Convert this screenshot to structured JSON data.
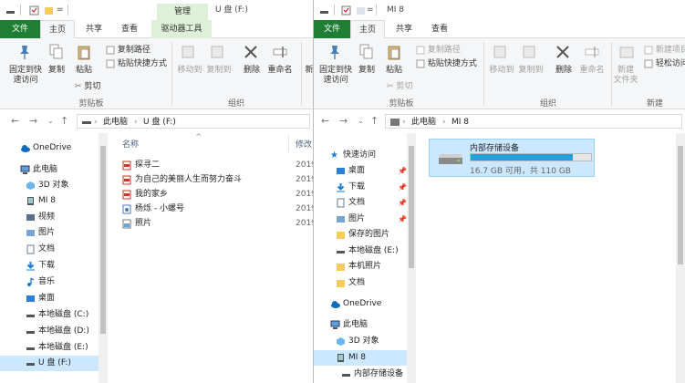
{
  "left_window": {
    "title": "U 盘 (F:)",
    "context_header": "管理",
    "tabs": [
      "文件",
      "主页",
      "共享",
      "查看",
      "驱动器工具"
    ],
    "ribbon": {
      "pin": "固定到快\n速访问",
      "copy": "复制",
      "paste": "粘贴",
      "copy_path": "复制路径",
      "paste_shortcut": "粘贴快捷方式",
      "cut": "剪切",
      "move_to": "移动到",
      "copy_to": "复制到",
      "delete": "删除",
      "rename": "重命名",
      "new": "新",
      "group_clipboard": "剪贴板",
      "group_organize": "组织"
    },
    "breadcrumb": [
      "此电脑",
      "U 盘 (F:)"
    ],
    "columns": {
      "name": "名称",
      "modified": "修改"
    },
    "files": [
      {
        "name": "探寻二",
        "date": "2019"
      },
      {
        "name": "为自己的美丽人生而努力奋斗",
        "date": "2019"
      },
      {
        "name": "我的家乡",
        "date": "2019"
      },
      {
        "name": "杨烁 - 小螺号",
        "date": "2019"
      },
      {
        "name": "照片",
        "date": "2019"
      }
    ],
    "nav": [
      {
        "label": "OneDrive"
      },
      {
        "label": "此电脑"
      },
      {
        "label": "3D 对象"
      },
      {
        "label": "MI 8"
      },
      {
        "label": "视频"
      },
      {
        "label": "图片"
      },
      {
        "label": "文档"
      },
      {
        "label": "下载"
      },
      {
        "label": "音乐"
      },
      {
        "label": "桌面"
      },
      {
        "label": "本地磁盘 (C:)"
      },
      {
        "label": "本地磁盘 (D:)"
      },
      {
        "label": "本地磁盘 (E:)"
      },
      {
        "label": "U 盘 (F:)"
      }
    ]
  },
  "right_window": {
    "title": "MI 8",
    "tabs": [
      "文件",
      "主页",
      "共享",
      "查看"
    ],
    "ribbon": {
      "pin": "固定到快\n速访问",
      "copy": "复制",
      "paste": "粘贴",
      "copy_path": "复制路径",
      "paste_shortcut": "粘贴快捷方式",
      "cut": "剪切",
      "move_to": "移动到",
      "copy_to": "复制到",
      "delete": "删除",
      "rename": "重命名",
      "new_folder": "新建\n文件夹",
      "new_item": "新建项目",
      "easy_access": "轻松访问",
      "group_clipboard": "剪贴板",
      "group_organize": "组织",
      "group_new": "新建"
    },
    "breadcrumb": [
      "此电脑",
      "MI 8"
    ],
    "storage": {
      "name": "内部存储设备",
      "info": "16.7 GB 可用，共 110 GB",
      "used_fraction": 0.85
    },
    "nav": [
      {
        "label": "快速访问"
      },
      {
        "label": "桌面"
      },
      {
        "label": "下载"
      },
      {
        "label": "文档"
      },
      {
        "label": "图片"
      },
      {
        "label": "保存的图片"
      },
      {
        "label": "本地磁盘 (E:)"
      },
      {
        "label": "本机照片"
      },
      {
        "label": "文档"
      },
      {
        "label": "OneDrive"
      },
      {
        "label": "此电脑"
      },
      {
        "label": "3D 对象"
      },
      {
        "label": "MI 8"
      },
      {
        "label": "内部存储设备"
      }
    ]
  },
  "colors": {
    "file_tab": "#1e7e34",
    "selection": "#cce8ff",
    "storage_bar": "#26a0da",
    "context_header": "#dff0d8"
  }
}
